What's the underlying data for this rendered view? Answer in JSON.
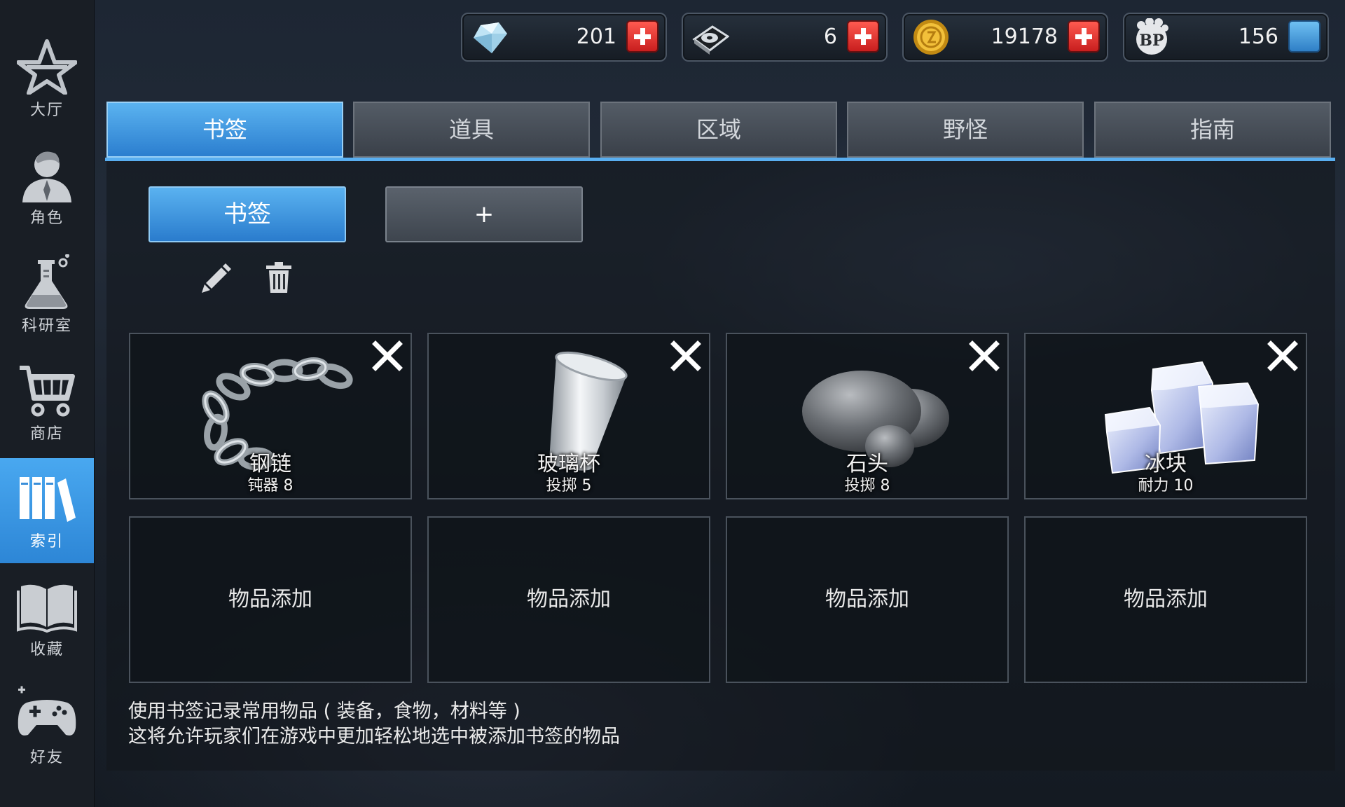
{
  "sidebar": {
    "items": [
      {
        "label": "大厅",
        "icon": "lobby-star-icon"
      },
      {
        "label": "角色",
        "icon": "character-icon"
      },
      {
        "label": "科研室",
        "icon": "lab-flask-icon"
      },
      {
        "label": "商店",
        "icon": "shop-cart-icon"
      },
      {
        "label": "索引",
        "icon": "index-books-icon"
      },
      {
        "label": "收藏",
        "icon": "collection-book-icon"
      },
      {
        "label": "好友",
        "icon": "friends-gamepad-icon"
      }
    ],
    "active_index": 4
  },
  "currencies": [
    {
      "icon": "diamond-icon",
      "value": "201",
      "action": "plus"
    },
    {
      "icon": "disc-icon",
      "value": "6",
      "action": "plus"
    },
    {
      "icon": "gold-coin-icon",
      "value": "19178",
      "action": "plus"
    },
    {
      "icon": "bp-badge-icon",
      "value": "156",
      "action": "card"
    }
  ],
  "tabs": [
    "书签",
    "道具",
    "区域",
    "野怪",
    "指南"
  ],
  "active_tab": 0,
  "bookmark_bar": {
    "bookmark_label": "书签",
    "add_label": "+"
  },
  "items": [
    {
      "name": "钢链",
      "stat": "钝器 8",
      "icon": "steel-chain-icon"
    },
    {
      "name": "玻璃杯",
      "stat": "投掷 5",
      "icon": "glass-cup-icon"
    },
    {
      "name": "石头",
      "stat": "投掷 8",
      "icon": "stone-icon"
    },
    {
      "name": "冰块",
      "stat": "耐力 10",
      "icon": "ice-cube-icon"
    }
  ],
  "empty_slots": [
    "物品添加",
    "物品添加",
    "物品添加",
    "物品添加"
  ],
  "hint": {
    "line1": "使用书签记录常用物品 ( 装备，食物，材料等 )",
    "line2": "这将允许玩家们在游戏中更加轻松地选中被添加书签的物品"
  },
  "colors": {
    "accent_blue": "#3a93e0",
    "plus_red": "#d8262a",
    "sidebar_bg": "#191e25"
  }
}
